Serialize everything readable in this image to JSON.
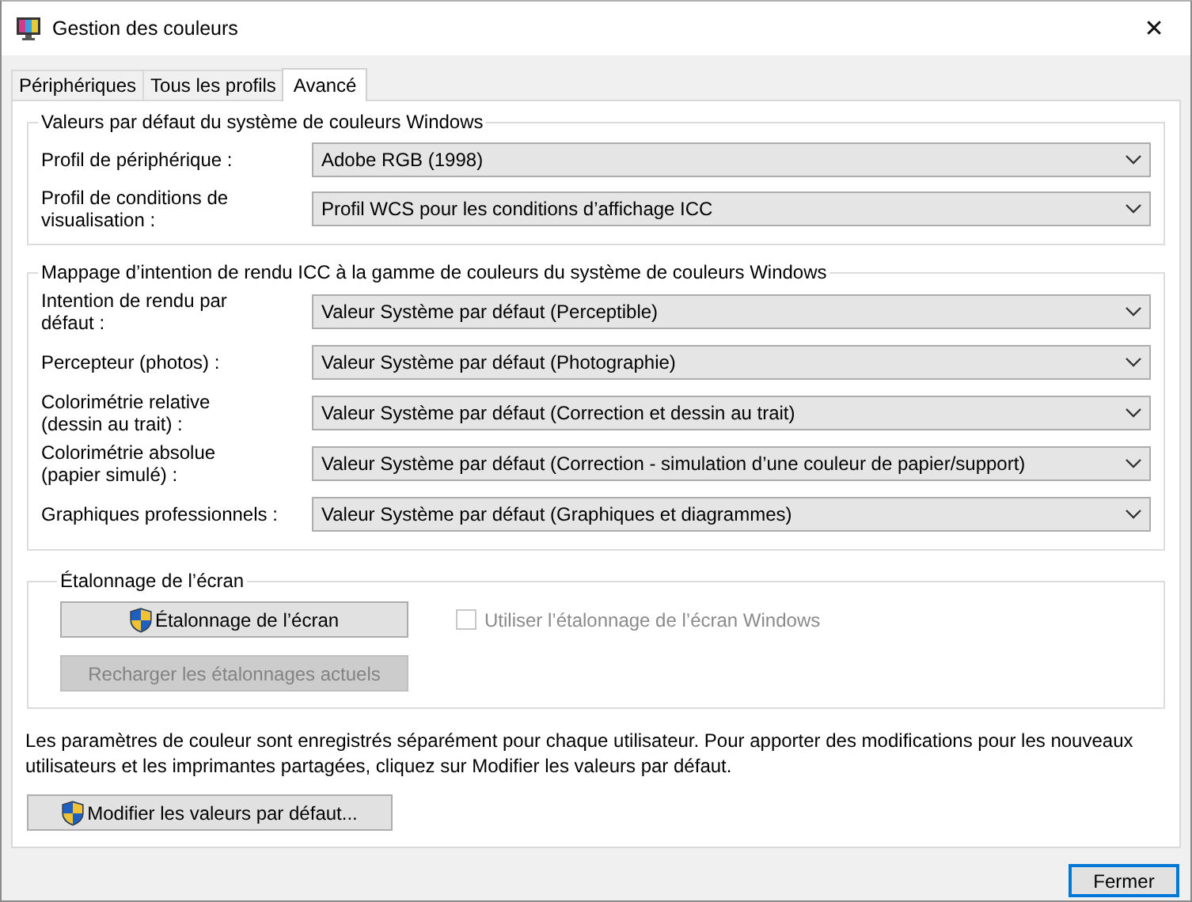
{
  "window": {
    "title": "Gestion des couleurs",
    "close_glyph": "✕"
  },
  "tabs": [
    {
      "label": "Périphériques",
      "selected": false
    },
    {
      "label": "Tous les profils",
      "selected": false
    },
    {
      "label": "Avancé",
      "selected": true
    }
  ],
  "defaults": {
    "title": "Valeurs par défaut du système de couleurs Windows",
    "rows": [
      {
        "label": "Profil de périphérique :",
        "value": "Adobe RGB (1998)"
      },
      {
        "label": "Profil de conditions de\nvisualisation :",
        "value": "Profil WCS pour les conditions d’affichage ICC"
      }
    ]
  },
  "mapping": {
    "title": "Mappage d’intention de rendu ICC à la gamme de couleurs du système de couleurs Windows",
    "rows": [
      {
        "label": "Intention de rendu par\ndéfaut :",
        "value": "Valeur Système par défaut (Perceptible)"
      },
      {
        "label": "Percepteur (photos) :",
        "value": "Valeur Système par défaut (Photographie)"
      },
      {
        "label": "Colorimétrie relative\n(dessin au trait) :",
        "value": "Valeur Système par défaut (Correction et dessin au trait)"
      },
      {
        "label": "Colorimétrie absolue\n(papier simulé) :",
        "value": "Valeur Système par défaut (Correction - simulation d’une couleur de papier/support)"
      },
      {
        "label": "Graphiques professionnels :",
        "value": "Valeur Système par défaut (Graphiques et diagrammes)"
      }
    ]
  },
  "calibration": {
    "title": "Étalonnage de l’écran",
    "calibrate_button": {
      "label": "Étalonnage de l’écran",
      "disabled": false,
      "shield": true
    },
    "reload_button": {
      "label": "Recharger les étalonnages actuels",
      "disabled": true,
      "shield": false
    },
    "checkbox": {
      "label": "Utiliser l’étalonnage de l’écran Windows",
      "checked": false,
      "disabled": true
    }
  },
  "note": "Les paramètres de couleur sont enregistrés séparément pour chaque utilisateur. Pour apporter des modifications pour les nouveaux utilisateurs et les imprimantes partagées, cliquez sur Modifier les valeurs par défaut.",
  "modify_button": {
    "label": "Modifier les valeurs par défaut...",
    "disabled": false,
    "shield": true
  },
  "close_button": {
    "label": "Fermer"
  }
}
